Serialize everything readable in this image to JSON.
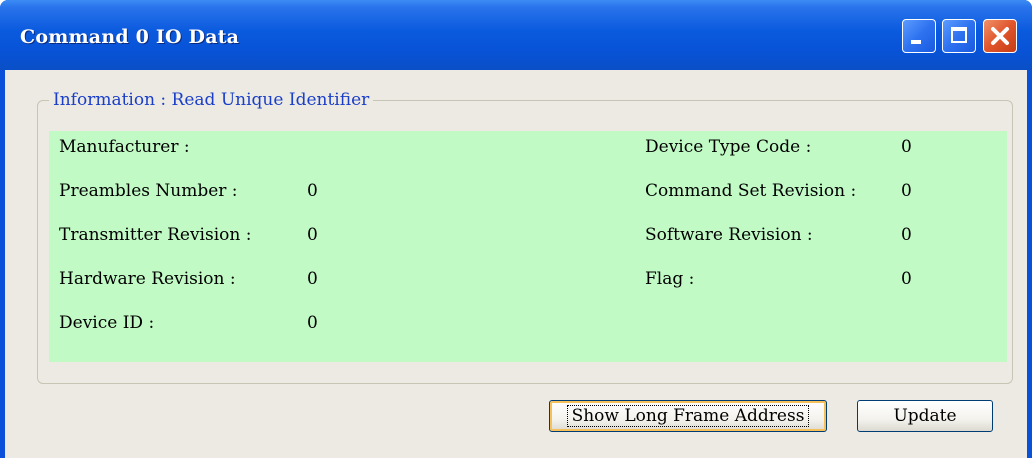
{
  "window": {
    "title": "Command 0 IO Data"
  },
  "group": {
    "legend": "Information : Read Unique Identifier"
  },
  "fields_left": [
    {
      "label": "Manufacturer :",
      "value": ""
    },
    {
      "label": "Preambles Number :",
      "value": "0"
    },
    {
      "label": "Transmitter Revision :",
      "value": "0"
    },
    {
      "label": "Hardware Revision :",
      "value": "0"
    },
    {
      "label": "Device ID :",
      "value": "0"
    }
  ],
  "fields_right": [
    {
      "label": "Device Type Code :",
      "value": "0"
    },
    {
      "label": "Command Set Revision :",
      "value": "0"
    },
    {
      "label": "Software Revision :",
      "value": "0"
    },
    {
      "label": "Flag :",
      "value": "0"
    }
  ],
  "buttons": {
    "show_long": "Show Long Frame Address",
    "update": "Update"
  },
  "colors": {
    "panel_bg": "#c1fac5",
    "legend_text": "#1a3ec8"
  }
}
